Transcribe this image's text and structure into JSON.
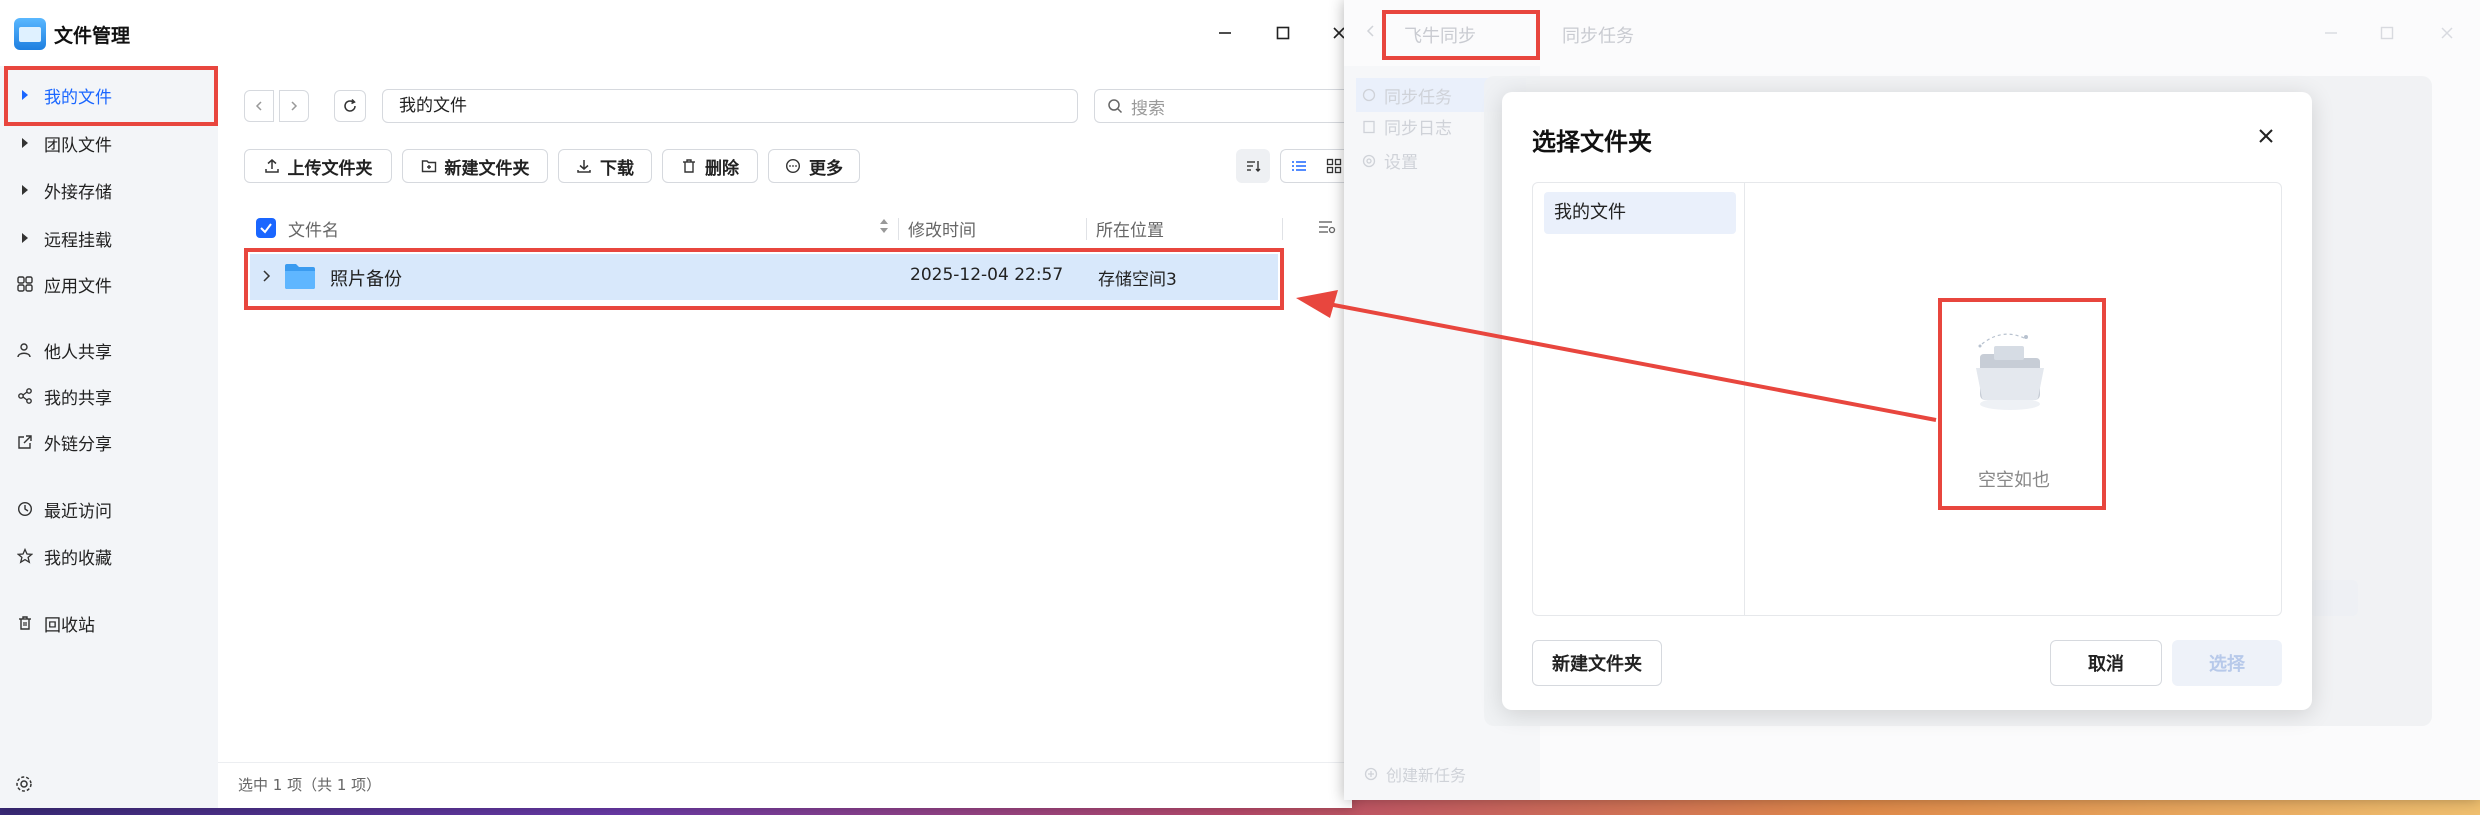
{
  "file_manager": {
    "title": "文件管理",
    "sidebar": {
      "items": [
        {
          "label": "我的文件",
          "icon": "caret-right-icon",
          "active": true
        },
        {
          "label": "团队文件",
          "icon": "caret-right-icon"
        },
        {
          "label": "外接存储",
          "icon": "caret-right-icon"
        },
        {
          "label": "远程挂载",
          "icon": "caret-right-icon"
        },
        {
          "label": "应用文件",
          "icon": "apps-icon"
        },
        {
          "label": "他人共享",
          "icon": "user-share-icon"
        },
        {
          "label": "我的共享",
          "icon": "share-icon"
        },
        {
          "label": "外链分享",
          "icon": "external-link-icon"
        },
        {
          "label": "最近访问",
          "icon": "clock-icon"
        },
        {
          "label": "我的收藏",
          "icon": "star-icon"
        },
        {
          "label": "回收站",
          "icon": "trash-icon"
        }
      ]
    },
    "path": "我的文件",
    "search_placeholder": "搜索",
    "toolbar": {
      "upload": "上传文件夹",
      "new_folder": "新建文件夹",
      "download": "下载",
      "delete": "删除",
      "more": "更多"
    },
    "table": {
      "columns": [
        "文件名",
        "修改时间",
        "所在位置"
      ],
      "rows": [
        {
          "name": "照片备份",
          "modified": "2025-12-04 22:57",
          "location": "存储空间3"
        }
      ]
    },
    "status": "选中 1 项（共 1 项）"
  },
  "sync_app": {
    "tabs": [
      "飞牛同步",
      "同步任务"
    ],
    "sidebar": [
      "同步任务",
      "同步日志",
      "设置"
    ],
    "create_task": "创建新任务"
  },
  "dialog": {
    "title": "选择文件夹",
    "tree": [
      "我的文件"
    ],
    "empty_text": "空空如也",
    "buttons": {
      "new_folder": "新建文件夹",
      "cancel": "取消",
      "select": "选择"
    }
  },
  "colors": {
    "accent": "#1a66ff",
    "highlight": "#e8463e",
    "row_selected": "#d8e8fb"
  }
}
